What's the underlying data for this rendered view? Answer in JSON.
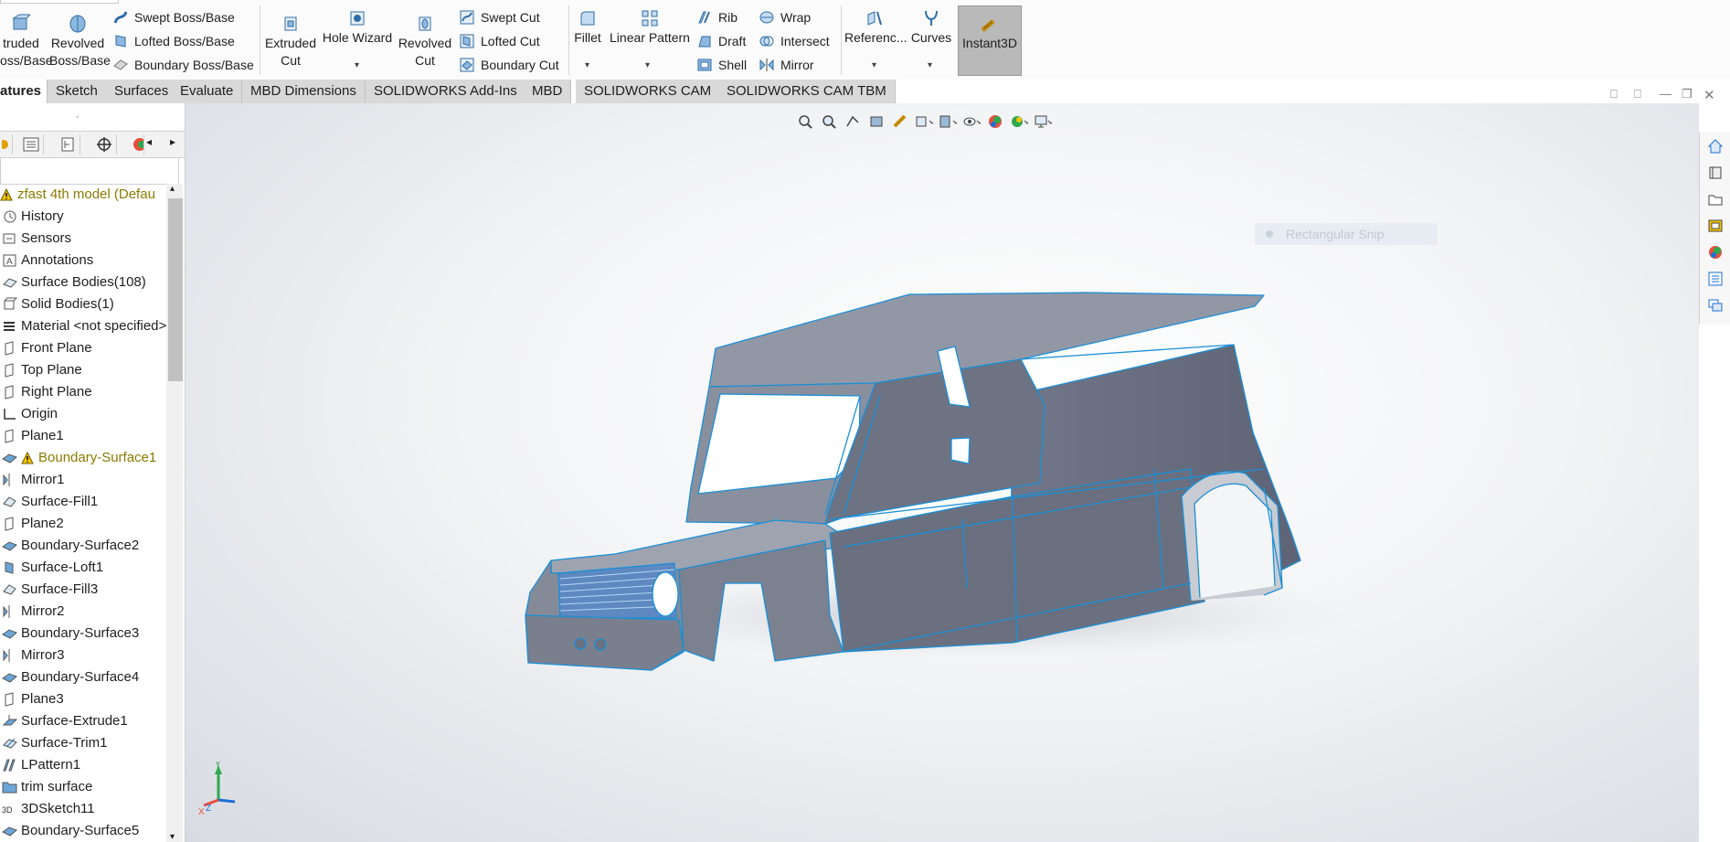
{
  "ribbon": {
    "extruded_boss": [
      "truded",
      "oss/Base"
    ],
    "revolved_boss": [
      "Revolved",
      "Boss/Base"
    ],
    "swept_boss": "Swept Boss/Base",
    "lofted_boss": "Lofted Boss/Base",
    "boundary_boss": "Boundary Boss/Base",
    "extruded_cut": [
      "Extruded",
      "Cut"
    ],
    "hole_wizard": "Hole Wizard",
    "revolved_cut": [
      "Revolved",
      "Cut"
    ],
    "swept_cut": "Swept Cut",
    "lofted_cut": "Lofted Cut",
    "boundary_cut": "Boundary Cut",
    "fillet": "Fillet",
    "linear_pattern": "Linear Pattern",
    "rib": "Rib",
    "draft": "Draft",
    "shell": "Shell",
    "wrap": "Wrap",
    "intersect": "Intersect",
    "mirror": "Mirror",
    "reference": "Referenc...",
    "curves": "Curves",
    "instant3d": "Instant3D"
  },
  "tabs": [
    "atures",
    "Sketch",
    "Surfaces",
    "Evaluate",
    "MBD Dimensions",
    "SOLIDWORKS Add-Ins",
    "MBD",
    "SOLIDWORKS CAM",
    "SOLIDWORKS CAM TBM"
  ],
  "tree": {
    "root": "zfast 4th model  (Defau",
    "items": [
      {
        "label": "History",
        "icon": "history-icon"
      },
      {
        "label": "Sensors",
        "icon": "sensors-icon"
      },
      {
        "label": "Annotations",
        "icon": "annotations-icon"
      },
      {
        "label": "Surface Bodies(108)",
        "icon": "surface-bodies-icon"
      },
      {
        "label": "Solid Bodies(1)",
        "icon": "solid-bodies-icon"
      },
      {
        "label": "Material <not specified>",
        "icon": "material-icon"
      },
      {
        "label": "Front Plane",
        "icon": "plane-icon"
      },
      {
        "label": "Top Plane",
        "icon": "plane-icon"
      },
      {
        "label": "Right Plane",
        "icon": "plane-icon"
      },
      {
        "label": "Origin",
        "icon": "origin-icon"
      },
      {
        "label": "Plane1",
        "icon": "plane-icon"
      },
      {
        "label": "Boundary-Surface1",
        "icon": "boundary-surface-icon",
        "warning": true
      },
      {
        "label": "Mirror1",
        "icon": "mirror-icon"
      },
      {
        "label": "Surface-Fill1",
        "icon": "surface-fill-icon"
      },
      {
        "label": "Plane2",
        "icon": "plane-icon"
      },
      {
        "label": "Boundary-Surface2",
        "icon": "boundary-surface-icon"
      },
      {
        "label": "Surface-Loft1",
        "icon": "surface-loft-icon"
      },
      {
        "label": "Surface-Fill3",
        "icon": "surface-fill-icon"
      },
      {
        "label": "Mirror2",
        "icon": "mirror-icon"
      },
      {
        "label": "Boundary-Surface3",
        "icon": "boundary-surface-icon"
      },
      {
        "label": "Mirror3",
        "icon": "mirror-icon"
      },
      {
        "label": "Boundary-Surface4",
        "icon": "boundary-surface-icon"
      },
      {
        "label": "Plane3",
        "icon": "plane-icon"
      },
      {
        "label": "Surface-Extrude1",
        "icon": "surface-extrude-icon"
      },
      {
        "label": "Surface-Trim1",
        "icon": "surface-trim-icon"
      },
      {
        "label": "LPattern1",
        "icon": "linear-pattern-icon"
      },
      {
        "label": "trim surface",
        "icon": "folder-icon"
      },
      {
        "label": "3DSketch11",
        "icon": "3dsketch-icon"
      },
      {
        "label": "Boundary-Surface5",
        "icon": "boundary-surface-icon"
      }
    ]
  },
  "viewport": {
    "snip_label": "Rectangular Snip"
  },
  "colors": {
    "edge_blue": "#1a8fd6",
    "body_gray": "#7f8696",
    "warning_text": "#8d7a00"
  }
}
